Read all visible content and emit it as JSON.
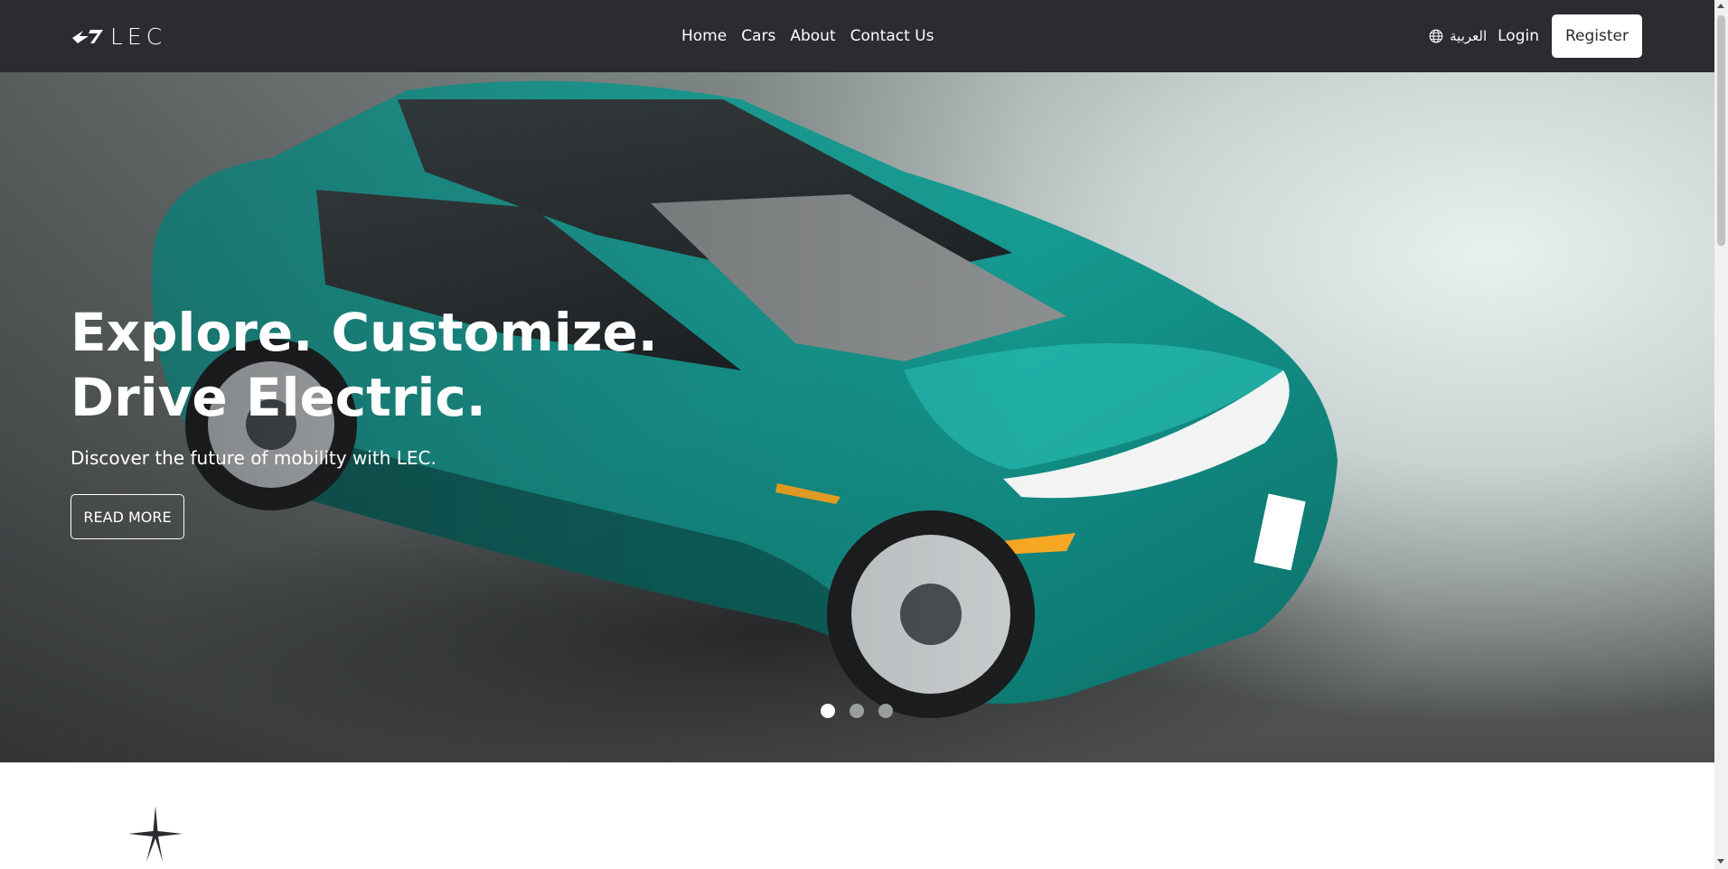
{
  "brand": {
    "name": "LEC"
  },
  "nav": {
    "links": [
      "Home",
      "Cars",
      "About",
      "Contact Us"
    ],
    "language_label": "العربية",
    "login_label": "Login",
    "register_label": "Register"
  },
  "hero": {
    "title_line1": "Explore. Customize.",
    "title_line2": "Drive Electric.",
    "subtitle": "Discover the future of mobility with LEC.",
    "cta_label": "READ MORE",
    "slides": 3,
    "active_slide": 1
  },
  "colors": {
    "navbar": "#2b2b30",
    "car_body": "#1aa39a",
    "text_light": "#ffffff"
  }
}
